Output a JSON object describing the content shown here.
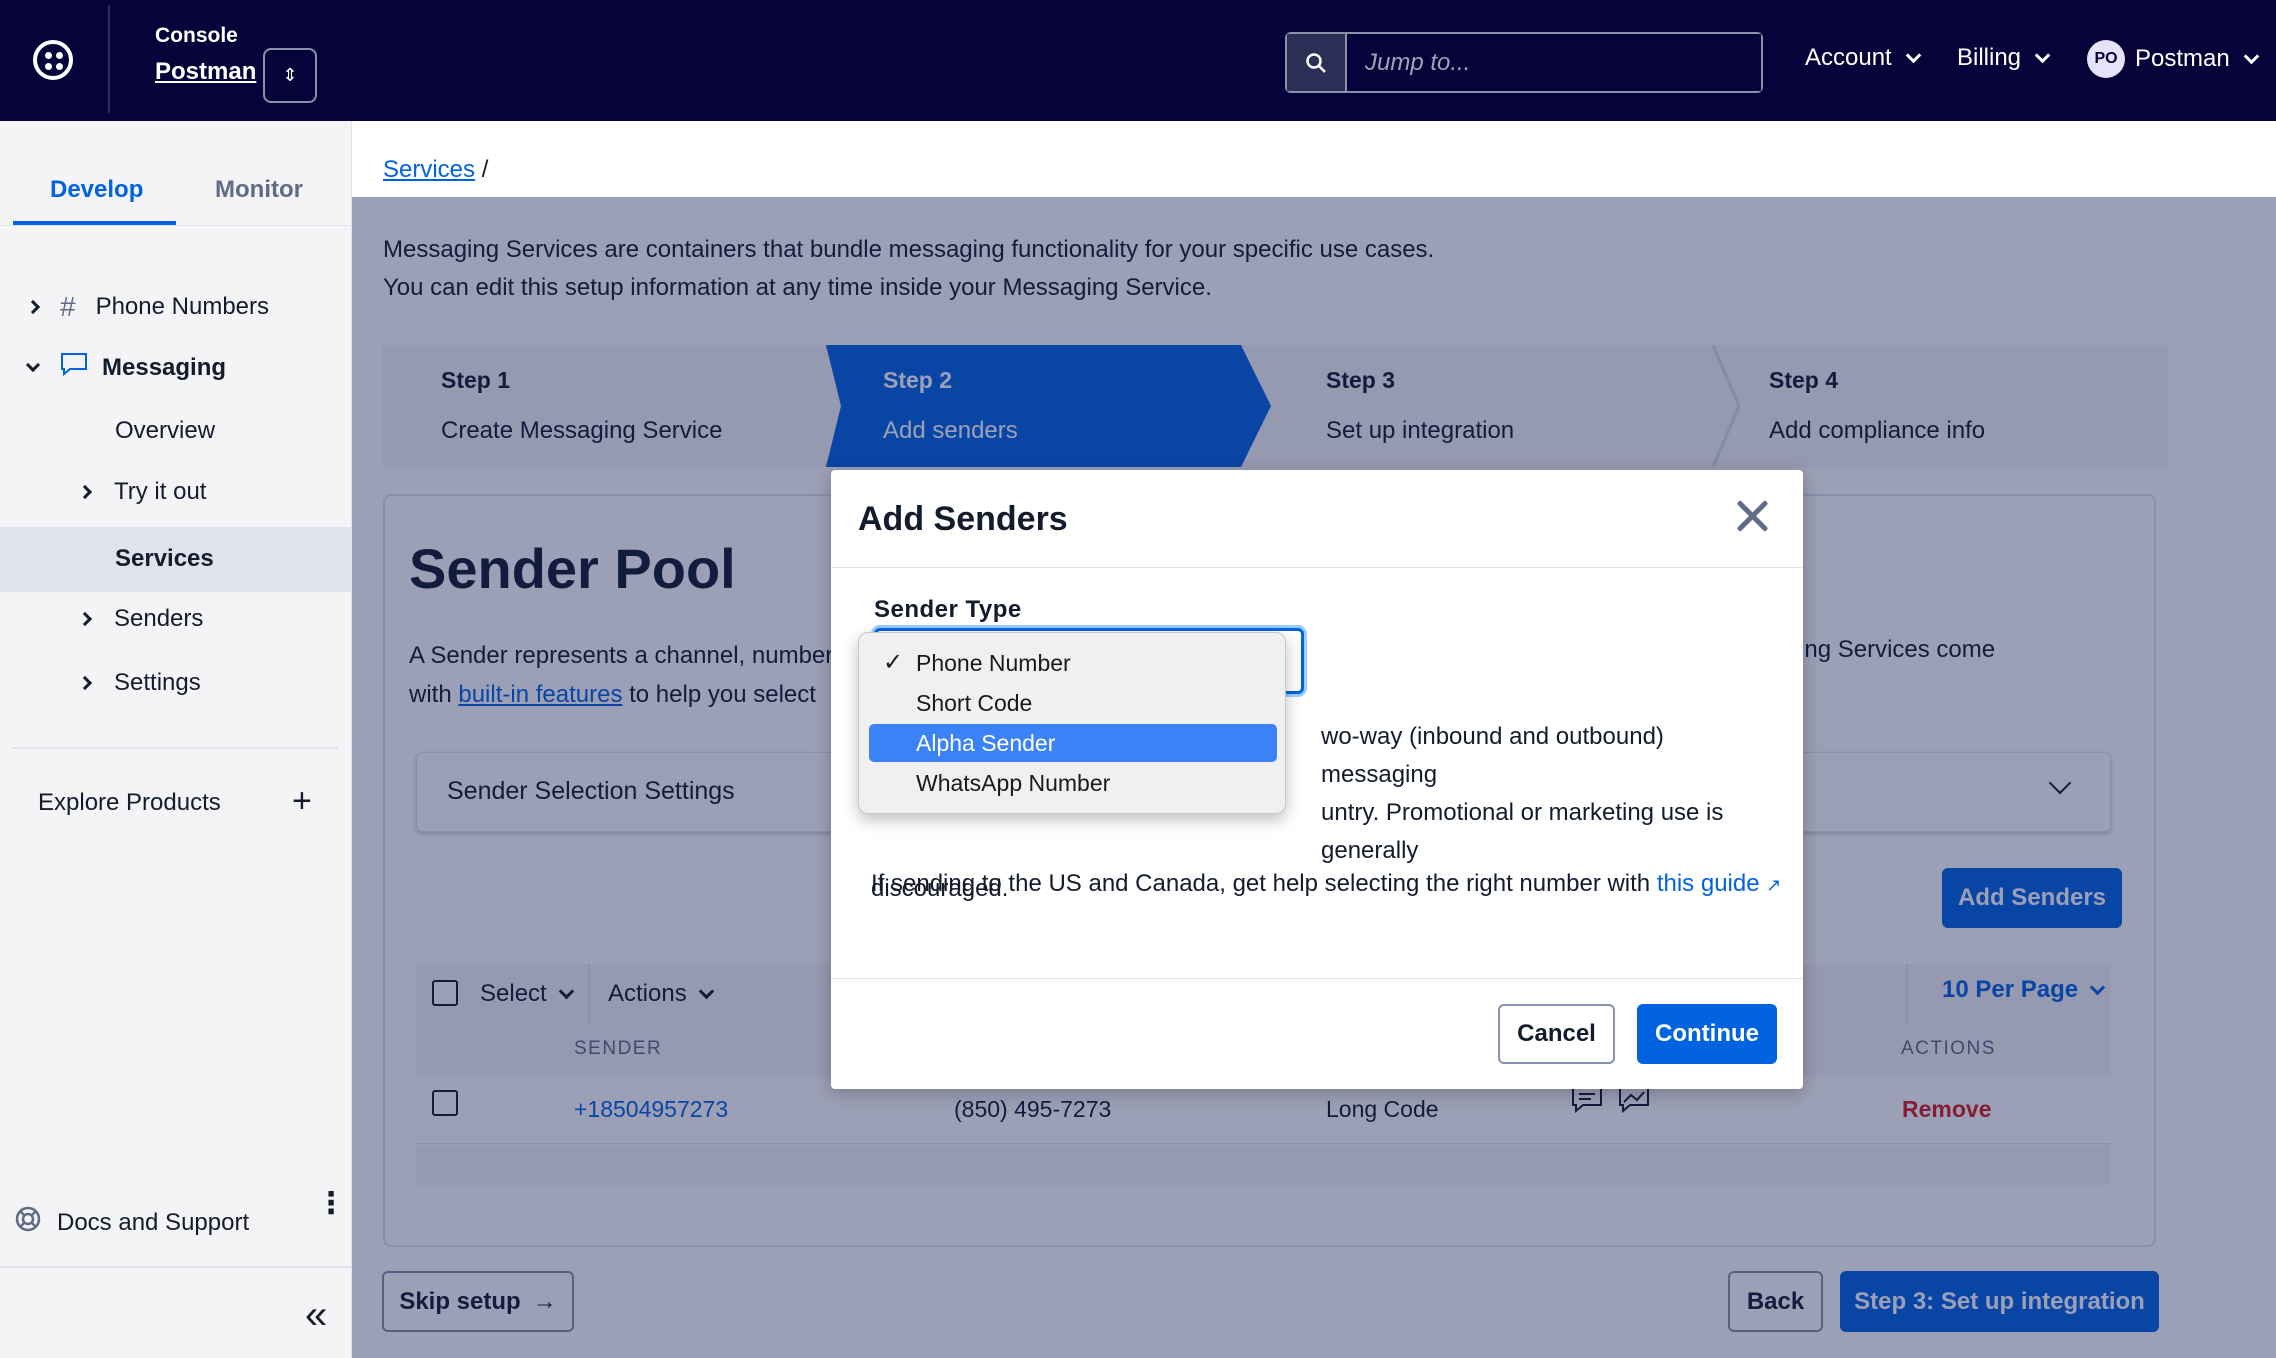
{
  "topbar": {
    "console_label": "Console",
    "account_name": "Postman",
    "search_placeholder": "Jump to...",
    "nav": [
      "Account",
      "Billing"
    ],
    "user_initials": "PO",
    "user_name": "Postman"
  },
  "sidebar": {
    "tabs": [
      "Develop",
      "Monitor"
    ],
    "items": [
      {
        "label": "Phone Numbers"
      },
      {
        "label": "Messaging"
      },
      {
        "label": "Overview"
      },
      {
        "label": "Try it out"
      },
      {
        "label": "Services"
      },
      {
        "label": "Senders"
      },
      {
        "label": "Settings"
      }
    ],
    "explore": "Explore Products",
    "docs": "Docs and Support"
  },
  "main": {
    "breadcrumb": "Services",
    "breadcrumb_sep": "/",
    "intro_line1": "Messaging Services are containers that bundle messaging functionality for your specific use cases.",
    "intro_line2": "You can edit this setup information at any time inside your Messaging Service.",
    "steps": [
      {
        "num": "Step 1",
        "label": "Create Messaging Service"
      },
      {
        "num": "Step 2",
        "label": "Add senders"
      },
      {
        "num": "Step 3",
        "label": "Set up integration"
      },
      {
        "num": "Step 4",
        "label": "Add compliance info"
      }
    ],
    "sender_pool_title": "Sender Pool",
    "sp_desc_a": "A Sender represents a channel, number",
    "sp_desc_b": "Messaging Services come",
    "sp_desc_with": "with",
    "sp_desc_link": "built-in features",
    "sp_desc_c": "to help you select",
    "selection_settings": "Sender Selection Settings",
    "add_senders_btn": "Add Senders",
    "table": {
      "select": "Select",
      "actions": "Actions",
      "per_page": "10 Per Page",
      "col_sender": "SENDER",
      "col_actions": "ACTIONS",
      "row": {
        "sender": "+18504957273",
        "friendly": "(850) 495-7273",
        "type": "Long Code",
        "action": "Remove"
      }
    },
    "skip_setup": "Skip setup",
    "back": "Back",
    "next": "Step 3: Set up integration"
  },
  "modal": {
    "title": "Add Senders",
    "field_label": "Sender Type",
    "text_line1": "wo-way (inbound and outbound) messaging",
    "text_line2": "untry. Promotional or marketing use is generally",
    "text_line3": "discouraged.",
    "help_text": "If sending to the US and Canada, get help selecting the right number with",
    "help_link": "this guide",
    "cancel": "Cancel",
    "continue": "Continue"
  },
  "dropdown": {
    "options": [
      "Phone Number",
      "Short Code",
      "Alpha Sender",
      "WhatsApp Number"
    ],
    "selected": "Phone Number",
    "highlighted": "Alpha Sender"
  },
  "colors": {
    "brand_dark": "#06033a",
    "primary": "#0263e0",
    "danger": "#d61f1f"
  }
}
